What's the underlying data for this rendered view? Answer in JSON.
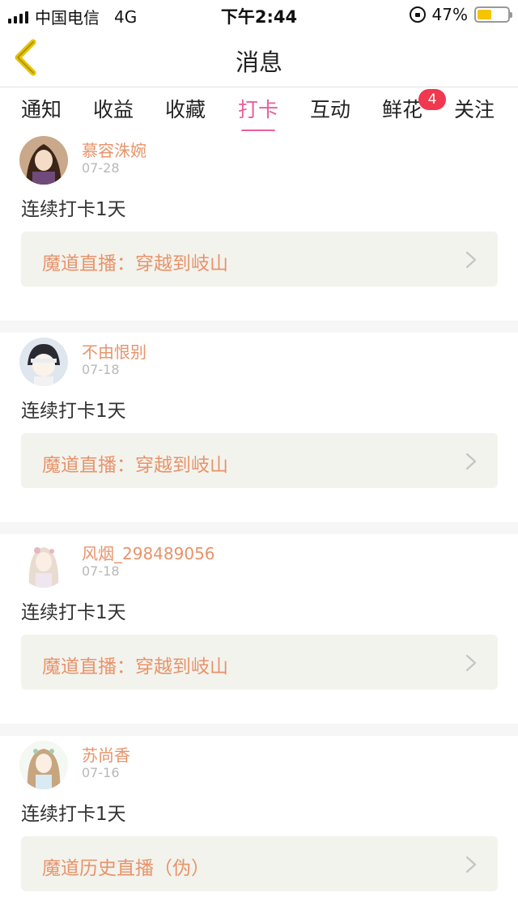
{
  "status_bar": {
    "carrier": "中国电信",
    "network": "4G",
    "time": "下午2:44",
    "battery": "47%",
    "battery_level": 0.47
  },
  "header": {
    "title": "消息"
  },
  "tabs": [
    {
      "label": "通知"
    },
    {
      "label": "收益"
    },
    {
      "label": "收藏"
    },
    {
      "label": "打卡",
      "active": true
    },
    {
      "label": "互动"
    },
    {
      "label": "鲜花",
      "badge": "4"
    },
    {
      "label": "关注"
    }
  ],
  "items": [
    {
      "username": "慕容洙婉",
      "date": "07-28",
      "message": "连续打卡1天",
      "link": "魔道直播：穿越到岐山"
    },
    {
      "username": "不由恨别",
      "date": "07-18",
      "message": "连续打卡1天",
      "link": "魔道直播：穿越到岐山"
    },
    {
      "username": "风烟_298489056",
      "date": "07-18",
      "message": "连续打卡1天",
      "link": "魔道直播：穿越到岐山"
    },
    {
      "username": "苏尚香",
      "date": "07-16",
      "message": "连续打卡1天",
      "link": "魔道历史直播（伪）"
    }
  ],
  "colors": {
    "accent_pink": "#e85f9c",
    "username_orange": "#e8936a",
    "badge_red": "#f0384f",
    "back_arrow": "#e6c200"
  }
}
